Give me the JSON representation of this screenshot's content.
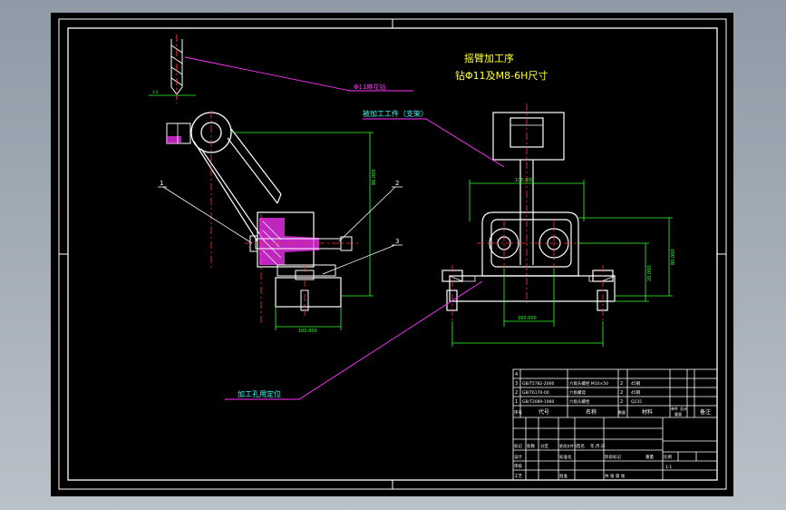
{
  "title": {
    "line1": "摇臂加工序",
    "line2": "钻Φ11及M8-6H尺寸"
  },
  "labels": {
    "drill": "Φ11麻花钻",
    "workpiece": "被加工工件（支架）",
    "locating": "加工孔用定位",
    "p1": "1",
    "p2": "2",
    "p3": "3"
  },
  "dimensions": {
    "left_vertical": "86.000",
    "left_bottom": "100.000",
    "right_top": "105.000",
    "right_vertical": "80.000",
    "right_mid": "20.000",
    "right_bottom": "160.000",
    "small_top": "3.0"
  },
  "parts_list": [
    {
      "no": "4",
      "code": "",
      "name": "",
      "qty": "",
      "material": ""
    },
    {
      "no": "3",
      "code": "GB/T5782-2000",
      "name": "六角头螺栓 M10×50",
      "qty": "2",
      "material": "45钢"
    },
    {
      "no": "2",
      "code": "GB/T6170-00",
      "name": "六角螺母",
      "qty": "2",
      "material": "45钢"
    },
    {
      "no": "1",
      "code": "GB/T2089-1980",
      "name": "六角头螺栓",
      "qty": "2",
      "material": "Q235"
    }
  ],
  "parts_header": {
    "no": "序号",
    "code": "代号",
    "name": "名称",
    "qty": "数量",
    "material": "材料",
    "unit_weight": "单件",
    "total_weight": "总计",
    "weight": "重量",
    "remark": "备注"
  },
  "title_block": {
    "marks": "标记",
    "count": "处数",
    "zone": "分区",
    "change_doc": "更改文件号",
    "signature": "签名",
    "date": "年.月.日",
    "design": "设计",
    "standardize": "标准化",
    "check": "审核",
    "process": "工艺",
    "approve": "批准",
    "stage_mark": "阶段标记",
    "weight": "重量",
    "scale": "比例",
    "scale_value": "1:1",
    "sheets": "共 张 第 张"
  }
}
